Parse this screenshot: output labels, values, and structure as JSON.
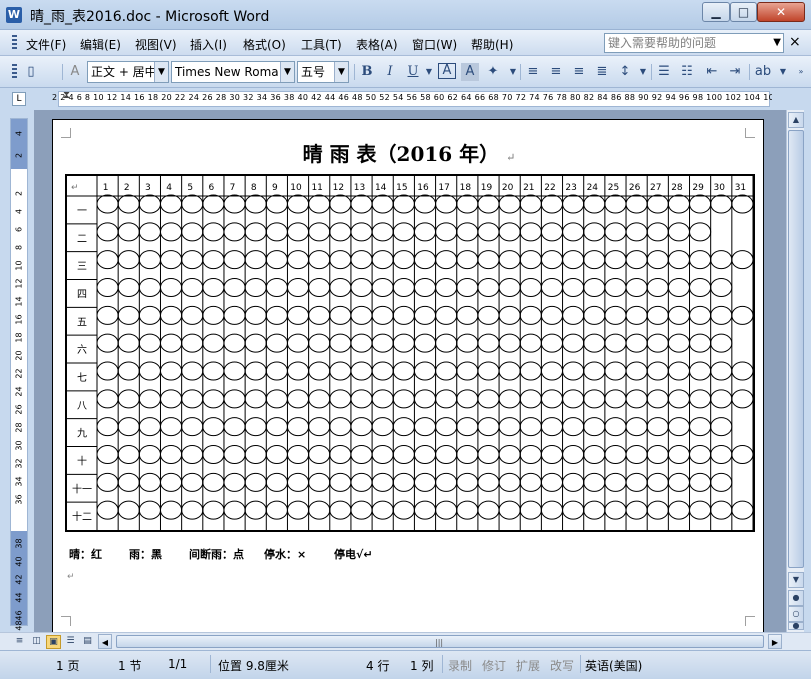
{
  "window": {
    "title": "晴_雨_表2016.doc - Microsoft Word",
    "minimize_label": "▁",
    "maximize_label": "□",
    "close_label": "✕",
    "app_icon_label": "W"
  },
  "menu": {
    "items": [
      "文件(F)",
      "编辑(E)",
      "视图(V)",
      "插入(I)",
      "格式(O)",
      "工具(T)",
      "表格(A)",
      "窗口(W)",
      "帮助(H)"
    ],
    "help_placeholder": "键入需要帮助的问题",
    "close_doc_label": "×"
  },
  "toolbar": {
    "style_value": "正文 + 居中",
    "font_value": "Times New Roma",
    "size_value": "五号",
    "icons": [
      "new-doc-icon",
      "styles-icon",
      "bold-icon",
      "italic-icon",
      "underline-icon",
      "char-border-icon",
      "char-shading-icon",
      "highlight-icon",
      "align-left-icon",
      "center-icon",
      "align-right-icon",
      "justify-icon",
      "line-spacing-icon",
      "numbering-icon",
      "bullets-icon",
      "decrease-indent-icon",
      "increase-indent-icon",
      "font-color-icon"
    ]
  },
  "ruler": {
    "tab_selector": "L",
    "numbers": "2  2  4  6  8 10 12 14 16 18 20 22 24 26 28 30 32 34 36 38 40 42 44 46 48 50 52 54 56 58 60 62 64 66 68 70 72 74 76 78 80 82 84 86 88 90 92 94 96 98 100 102 104 106  110",
    "vertical_numbers": [
      "4",
      "2",
      "2",
      "4",
      "6",
      "8",
      "10",
      "12",
      "14",
      "16",
      "18",
      "20",
      "22",
      "24",
      "26",
      "28",
      "30",
      "32",
      "34",
      "36",
      "38",
      "40",
      "42",
      "44",
      "46",
      "48"
    ]
  },
  "document": {
    "title": "晴 雨 表（2016 年）",
    "title_mark": "↵",
    "corner_mark": "↵",
    "days": [
      "1",
      "2",
      "3",
      "4",
      "5",
      "6",
      "7",
      "8",
      "9",
      "10",
      "11",
      "12",
      "13",
      "14",
      "15",
      "16",
      "17",
      "18",
      "19",
      "20",
      "21",
      "22",
      "23",
      "24",
      "25",
      "26",
      "27",
      "28",
      "29",
      "30",
      "31"
    ],
    "months": [
      "一",
      "二",
      "三",
      "四",
      "五",
      "六",
      "七",
      "八",
      "九",
      "十",
      "十一",
      "十二"
    ],
    "days_in_month": [
      31,
      29,
      31,
      30,
      31,
      30,
      31,
      31,
      30,
      31,
      30,
      31
    ],
    "legend": [
      {
        "text": "晴：红"
      },
      {
        "text": "雨：黑"
      },
      {
        "text": "间断雨：点"
      },
      {
        "text": "停水：×"
      },
      {
        "text": "停电√↵"
      }
    ],
    "end_mark": "↵"
  },
  "statusbar": {
    "page": "1 页",
    "section": "1 节",
    "page_of": "1/1",
    "position": "位置 9.8厘米",
    "line": "4 行",
    "column": "1 列",
    "rec": "录制",
    "trk": "修订",
    "ext": "扩展",
    "ovr": "改写",
    "language": "英语(美国)"
  },
  "scrollbar": {
    "up": "▲",
    "down": "▼",
    "prev_page": "●",
    "select_browse": "○",
    "next_page": "●",
    "left": "◀",
    "right": "▶",
    "grip": "|||"
  },
  "views": [
    "normal-view-icon",
    "web-view-icon",
    "print-view-icon",
    "outline-view-icon",
    "reading-view-icon"
  ]
}
